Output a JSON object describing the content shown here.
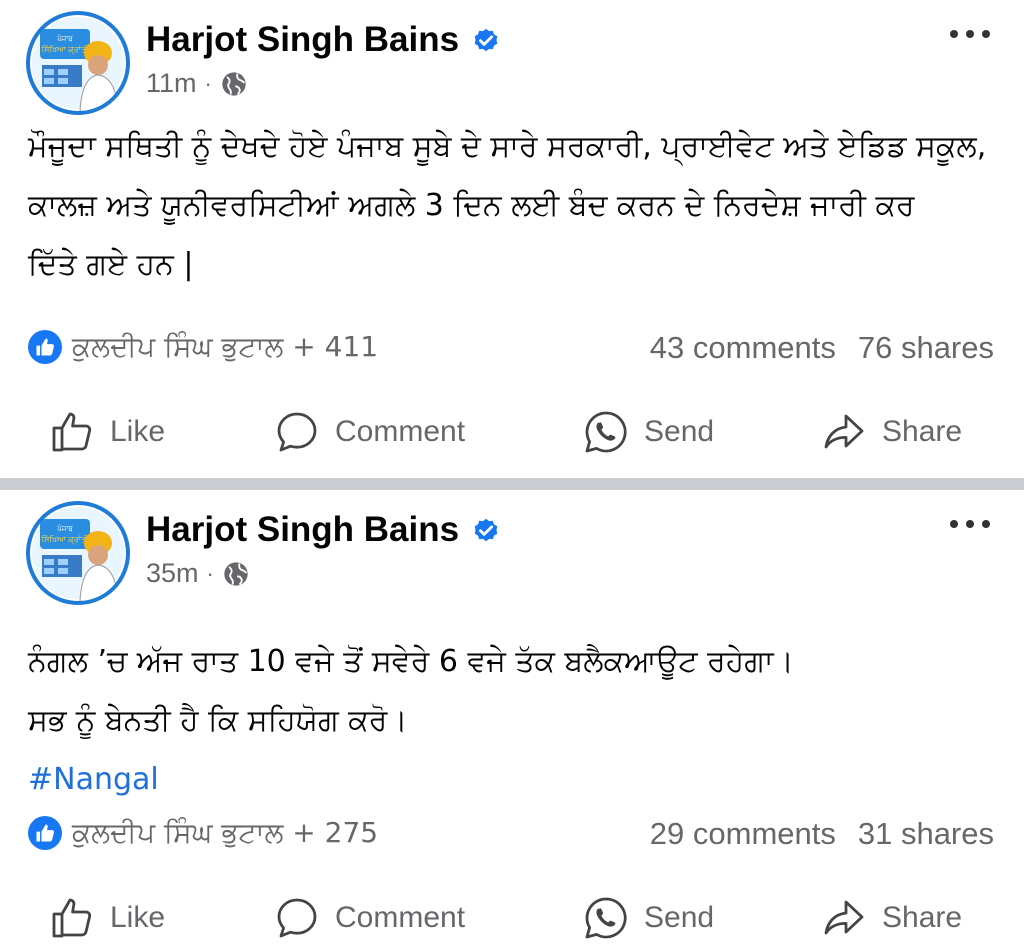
{
  "posts": [
    {
      "author": "Harjot Singh Bains",
      "time": "11m",
      "separator": "·",
      "lines": [
        "ਮੌਜੂਦਾ ਸਥਿਤੀ ਨੂੰ ਦੇਖਦੇ ਹੋਏ ਪੰਜਾਬ ਸੂਬੇ ਦੇ ਸਾਰੇ ਸਰਕਾਰੀ, ਪ੍ਰਾਈਵੇਟ ਅਤੇ ਏਡਿਡ ਸਕੂਲ,",
        "ਕਾਲਜ਼ ਅਤੇ ਯੂਨੀਵਰਸਿਟੀਆਂ ਅਗਲੇ 3 ਦਿਨ ਲਈ ਬੰਦ ਕਰਨ ਦੇ ਨਿਰਦੇਸ਼ ਜਾਰੀ ਕਰ",
        "ਦਿੱਤੇ ਗਏ ਹਨ |"
      ],
      "hashtag": "",
      "reactors": "ਕੁਲਦੀਪ ਸਿੰਘ ਭੁਟਾਲ + 411",
      "comments": "43 comments",
      "shares": "76 shares"
    },
    {
      "author": "Harjot Singh Bains",
      "time": "35m",
      "separator": "·",
      "lines": [
        "ਨੰਗਲ ’ਚ ਅੱਜ ਰਾਤ 10 ਵਜੇ ਤੋਂ ਸਵੇਰੇ 6 ਵਜੇ ਤੱਕ ਬਲੈਕਆਊਟ ਰਹੇਗਾ।",
        "ਸਭ ਨੂੰ ਬੇਨਤੀ ਹੈ ਕਿ ਸਹਿਯੋਗ ਕਰੋ।"
      ],
      "hashtag": "#Nangal",
      "reactors": "ਕੁਲਦੀਪ ਸਿੰਘ ਭੁਟਾਲ + 275",
      "comments": "29 comments",
      "shares": "31 shares"
    }
  ],
  "actions": {
    "like": "Like",
    "comment": "Comment",
    "send": "Send",
    "share": "Share"
  },
  "avatar_badge_text": "ਪੰਜਾਬ ਸਿੱਖਿਆ ਕ੍ਰਾਂਤੀ",
  "icons": {
    "verified": "verified-badge-icon",
    "privacy": "globe-icon",
    "more": "more-options-icon",
    "reaction": "like-reaction-icon"
  },
  "colors": {
    "accent": "#1877f2",
    "link": "#216fdb",
    "muted": "#65676b",
    "separator": "#c9ccd1"
  }
}
